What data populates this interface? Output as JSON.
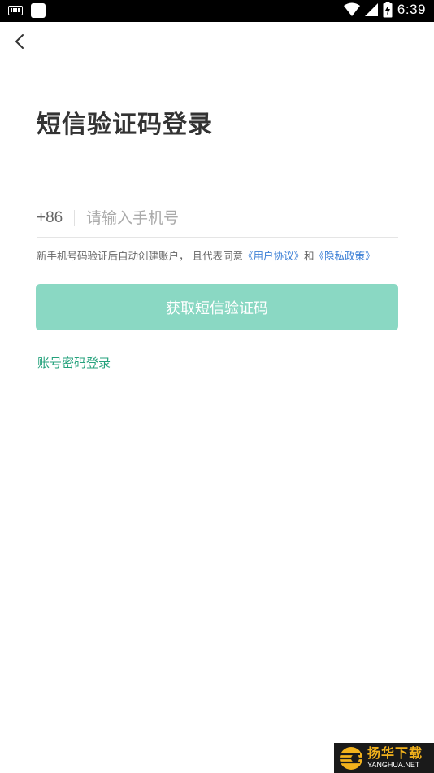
{
  "status_bar": {
    "time": "6:39",
    "icons": [
      "keyboard-icon",
      "app-notification-icon",
      "wifi-icon",
      "cellular-signal-icon",
      "battery-charging-icon"
    ]
  },
  "header": {
    "back_icon": "chevron-left-icon",
    "title": "短信验证码登录"
  },
  "phone_input": {
    "country_code": "+86",
    "placeholder": "请输入手机号",
    "value": ""
  },
  "agreement": {
    "prefix": "新手机号码验证后自动创建账户， 且代表同意",
    "user_agreement": "《用户协议》",
    "conjunction": "和",
    "privacy_policy": "《隐私政策》"
  },
  "actions": {
    "get_code_label": "获取短信验证码",
    "password_login_label": "账号密码登录"
  },
  "watermark": {
    "name_cn": "扬华下载",
    "name_en": "YANGHUA.NET"
  },
  "colors": {
    "primary_button": "#8ad8c3",
    "link_blue": "#3b7fd6",
    "link_green": "#25a27c",
    "title": "#333333"
  }
}
